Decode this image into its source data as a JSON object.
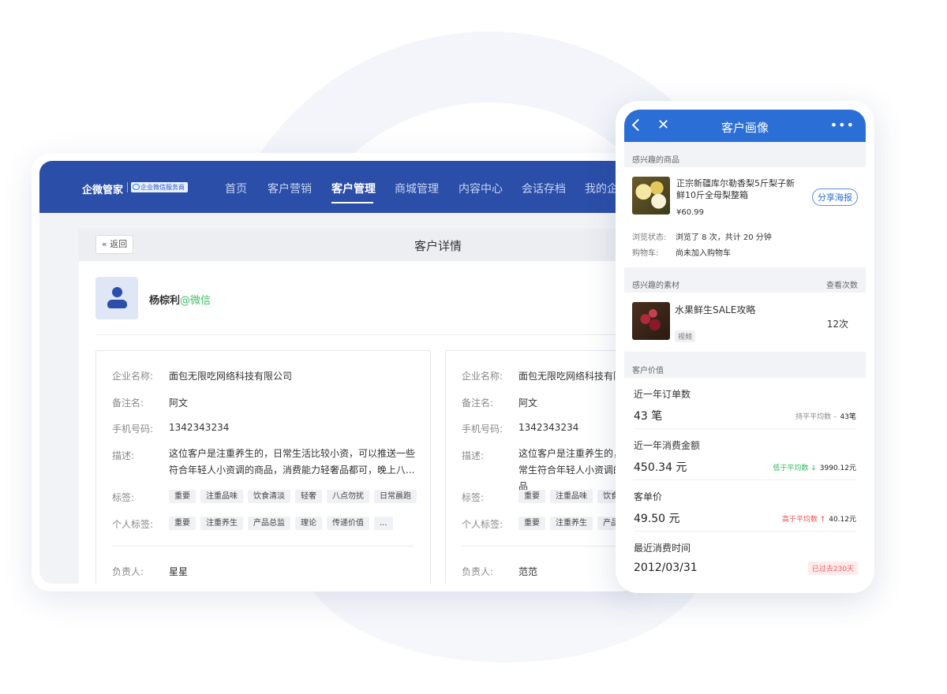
{
  "desktop": {
    "brand": "企微管家",
    "brand_badge": "企业微信服务商",
    "nav": [
      "首页",
      "客户营销",
      "客户管理",
      "商城管理",
      "内容中心",
      "会话存档",
      "我的企"
    ],
    "nav_active": "客户管理",
    "back_label": "返回",
    "page_title": "客户详情",
    "customer": {
      "name": "杨棕利",
      "source": "@微信"
    },
    "cards": [
      {
        "company_label": "企业名称:",
        "company": "面包无限吃网络科技有限公司",
        "remark_label": "备注名:",
        "remark": "阿文",
        "phone_label": "手机号码:",
        "phone": "1342343234",
        "desc_label": "描述:",
        "desc": "这位客户是注重养生的，日常生活比较小资，可以推送一些符合年轻人小资调的商品，消费能力轻奢品都可，晚上八...",
        "tags_label": "标签:",
        "tags": [
          "重要",
          "注重品味",
          "饮食清淡",
          "轻奢",
          "八点勿扰",
          "日常晨跑"
        ],
        "personal_tags_label": "个人标签:",
        "personal_tags": [
          "重要",
          "注重养生",
          "产品总监",
          "理论",
          "传递价值",
          "..."
        ],
        "owner_label": "负责人:",
        "owner": "星星"
      },
      {
        "company_label": "企业名称:",
        "company": "面包无限吃网络科技有限公",
        "remark_label": "备注名:",
        "remark": "阿文",
        "phone_label": "手机号码:",
        "phone": "1342343234",
        "desc_label": "描述:",
        "desc": "这位客户是注重养生的，日常生符合年轻人小资调的商品",
        "tags_label": "标签:",
        "tags": [
          "重要",
          "注重品味",
          "饮食"
        ],
        "personal_tags_label": "个人标签:",
        "personal_tags": [
          "重要",
          "注重养生",
          "产品"
        ],
        "owner_label": "负责人:",
        "owner": "范范"
      }
    ]
  },
  "phone": {
    "title": "客户画像",
    "products_label": "感兴趣的商品",
    "product": {
      "name": "正宗新疆库尔勒香梨5斤梨子新鲜10斤全母梨整箱",
      "price": "¥60.99",
      "share": "分享海报"
    },
    "browse_label": "浏览状态:",
    "browse": "浏览了 8 次，共计 20 分钟",
    "cart_label": "购物车:",
    "cart": "尚未加入购物车",
    "materials_label": "感兴趣的素材",
    "views_label": "查看次数",
    "material": {
      "title": "水果鲜生SALE攻略",
      "type": "视频",
      "count": "12次"
    },
    "value_label": "客户价值",
    "values": [
      {
        "label": "近一年订单数",
        "value": "43 笔",
        "cmp_text": "持平平均数 –",
        "cmp_num": "43笔",
        "cmp_color": "#888888"
      },
      {
        "label": "近一年消费金额",
        "value": "450.34 元",
        "cmp_text": "低于平均数 ↓",
        "cmp_num": "3990.12元",
        "cmp_color": "#2fb45a"
      },
      {
        "label": "客单价",
        "value": "49.50 元",
        "cmp_text": "高于平均数 ↑",
        "cmp_num": "40.12元",
        "cmp_color": "#f05050"
      }
    ],
    "last_label": "最近消费时间",
    "last_date": "2012/03/31",
    "last_badge": "已过去230天"
  }
}
